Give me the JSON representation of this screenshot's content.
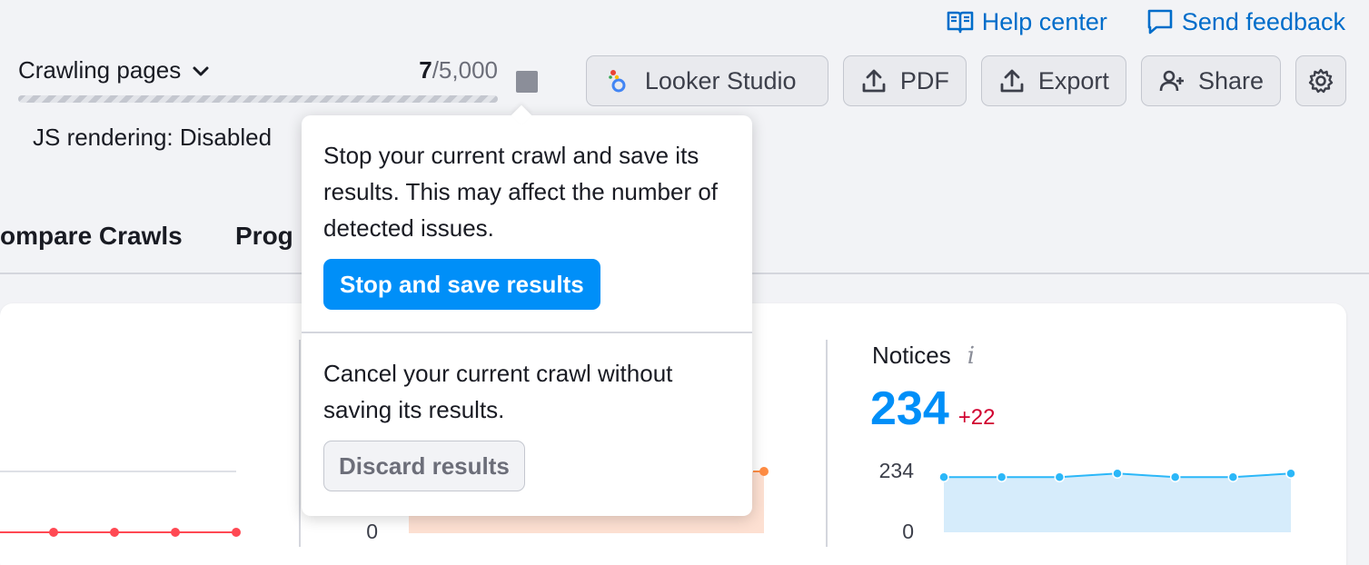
{
  "header": {
    "help_center": "Help center",
    "send_feedback": "Send feedback"
  },
  "crawl": {
    "status_label": "Crawling pages",
    "pages_crawled": "7",
    "separator": "/",
    "pages_limit": "5,000",
    "js_rendering": "JS rendering: Disabled"
  },
  "toolbar": {
    "looker_studio": "Looker Studio",
    "pdf": "PDF",
    "export": "Export",
    "share": "Share"
  },
  "tabs": [
    {
      "label": "ompare Crawls"
    },
    {
      "label": "Prog"
    }
  ],
  "popover": {
    "stop_text": "Stop your current crawl and save its results. This may affect the number of detected issues.",
    "stop_button": "Stop and save results",
    "cancel_text": "Cancel your current crawl without saving its results.",
    "discard_button": "Discard results"
  },
  "notices": {
    "title": "Notices",
    "value": "234",
    "delta": "+22"
  },
  "colors": {
    "accent": "#008ff8",
    "link": "#006dca",
    "errors_line": "#ff4953",
    "warnings_line": "#ff8c43",
    "notices_line": "#2bb7f8",
    "notices_fill": "#d6ecfb",
    "warnings_fill": "#fde0d2",
    "delta_red": "#d1002f"
  },
  "chart_data": [
    {
      "type": "line",
      "title": "",
      "series": [
        {
          "values": [
            0,
            0,
            0,
            0,
            0
          ]
        }
      ]
    },
    {
      "type": "area",
      "title": "",
      "yticks": [
        "0"
      ],
      "series": [
        {
          "values": [
            null
          ]
        }
      ]
    },
    {
      "type": "area",
      "title": "Notices",
      "yticks": [
        "234",
        "0"
      ],
      "ylim": [
        0,
        234
      ],
      "series": [
        {
          "values": [
            212,
            212,
            212,
            226,
            212,
            212,
            226
          ]
        }
      ]
    }
  ]
}
